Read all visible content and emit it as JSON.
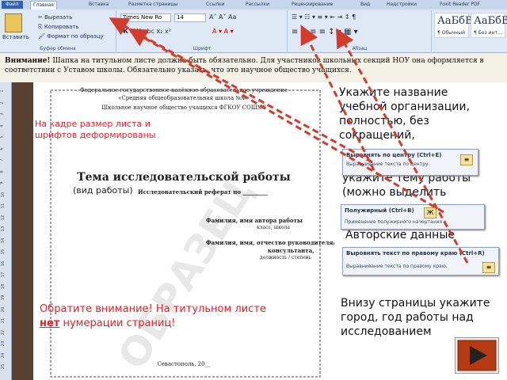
{
  "ribbon": {
    "tabs": [
      "Файл",
      "Главная",
      "Вставка",
      "Разметка страницы",
      "Ссылки",
      "Рассылки",
      "Рецензирование",
      "Вид",
      "Надстройки",
      "Foxit Reader PDF"
    ],
    "clipboard": {
      "paste": "Вставить",
      "cut": "Вырезать",
      "copy": "Копировать",
      "format_painter": "Формат по образцу",
      "label": "Буфер обмена"
    },
    "font": {
      "name": "Times New Ro",
      "size": "14",
      "label": "Шрифт"
    },
    "paragraph": {
      "label": "Абзац"
    },
    "styles": [
      {
        "sample": "АаБбВв",
        "name": "¶ Обычный"
      },
      {
        "sample": "АаБбВв",
        "name": "¶ Без инт..."
      }
    ]
  },
  "notice": {
    "bold": "Внимание!",
    "text": " Шапка на титульном листе должна быть обязательно. Для участников школьных секций НОУ она оформляется в соответствии с Уставом школы. Обязательно указать, что это научное общество учащихся."
  },
  "ruler": {
    "ticks": [
      "1",
      "2",
      "3",
      "4",
      "5",
      "6",
      "7",
      "8",
      "9",
      "10",
      "11",
      "12",
      "13",
      "14",
      "15",
      "16",
      "17",
      "18",
      "19",
      "20",
      "21",
      "22",
      "23",
      "24",
      "25"
    ]
  },
  "document": {
    "header1": "Федеральное государственное казённое образовательное учреждение",
    "header2": "«Средняя общеобразовательная школа №№»",
    "header3": "Школьное научное общество учащихся  ФГКОУ СОШ№8",
    "title": "Тема исследовательской работы",
    "work_type_note": "(вид работы)",
    "work_type": "Исследовательский реферат по _________",
    "author1": "Фамилия, имя автора работы",
    "author2": "класс, школа",
    "advisor1": "Фамилия, имя, отчество руководителя/",
    "advisor2": "консультанта,",
    "advisor3": "должность / степень",
    "city": "Севастополь, 20__",
    "watermark": "ОБРАЗЕЦ"
  },
  "annotations": {
    "frame_note": "На кадре размер листа и шрифтов деформированы",
    "warning_part1": "Обратите внимание! На титульном листе ",
    "warning_emph": "нет",
    "warning_part2": " нумерации страниц!"
  },
  "right_panel": {
    "p1": "Укажите название учебной организации, полностью,  без сокращений,",
    "p2": "Отступите ~ 3см вниз, укажите тему работы (можно выделить",
    "p3": "Авторские данные",
    "p4": "Внизу страницы укажите город, год работы над исследованием"
  },
  "tooltips": {
    "center": {
      "title": "Выровнять по центру (Ctrl+E)",
      "desc": "Выравнивание текста по центру."
    },
    "bold": {
      "title": "Полужирный (Ctrl+B)",
      "desc": "Применение полужирного начертания к",
      "icon": "Ж"
    },
    "right": {
      "title": "Выровнять текст по правому краю (Ctrl+R)",
      "desc": "Выравнивание текста по правому краю."
    }
  },
  "colors": {
    "red": "#e0212b",
    "arrow": "#d53b2b",
    "accent": "#2d62b5"
  }
}
